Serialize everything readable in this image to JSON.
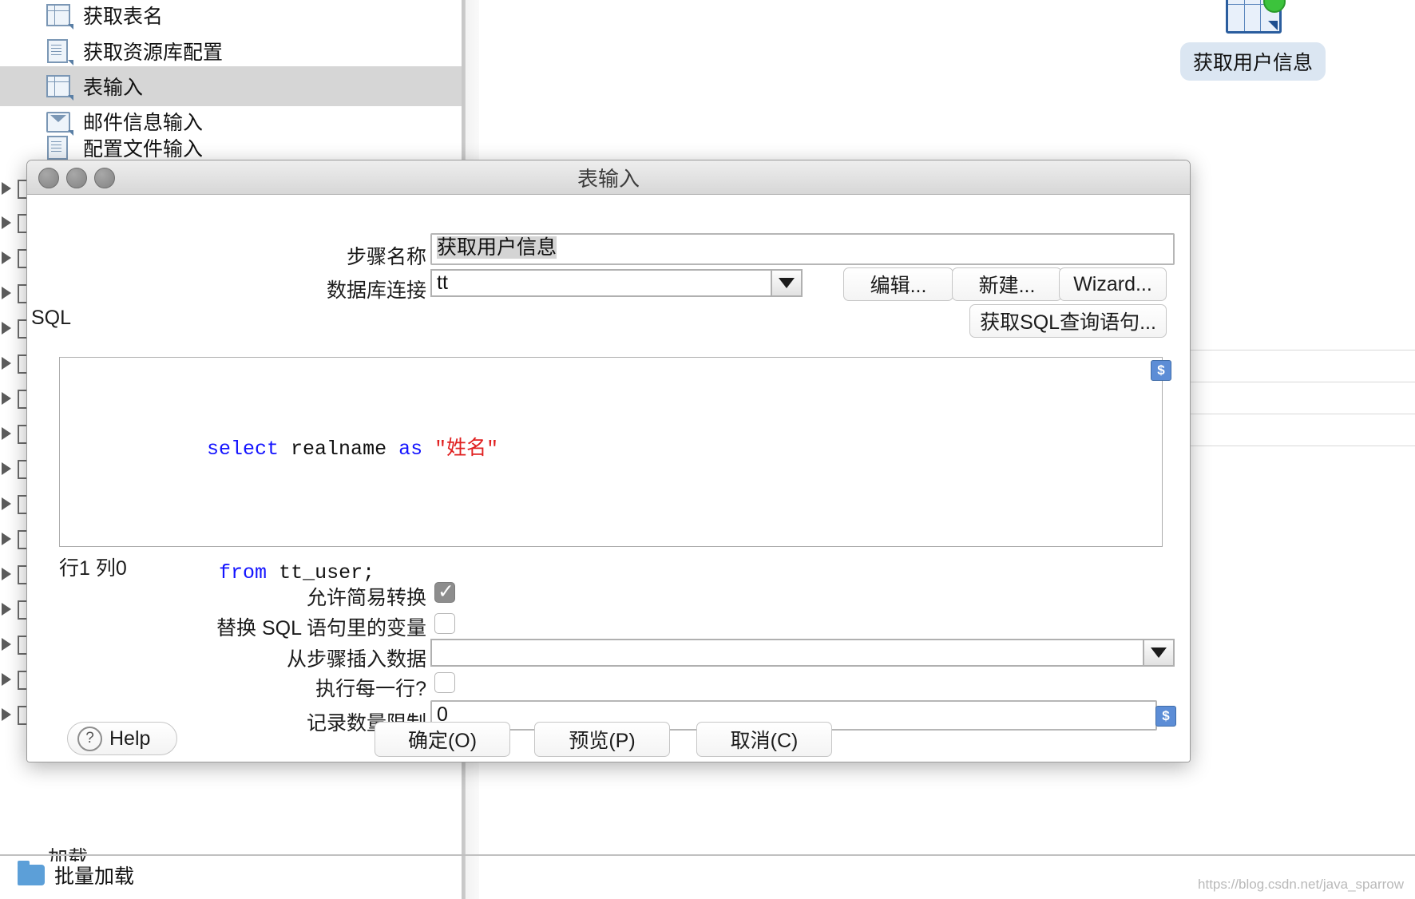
{
  "background": {
    "tree_items": [
      {
        "label": "获取表名",
        "icon": "table-icon",
        "selected": false
      },
      {
        "label": "获取资源库配置",
        "icon": "document-icon",
        "selected": false
      },
      {
        "label": "表输入",
        "icon": "table-icon",
        "selected": true
      },
      {
        "label": "邮件信息输入",
        "icon": "mail-icon",
        "selected": false
      },
      {
        "label": "配置文件输入",
        "icon": "list-icon",
        "selected": false
      }
    ],
    "canvas_node_label": "获取用户信息",
    "bottom_folder_label": "批量加载",
    "partial_label": "加载",
    "watermark": "https://blog.csdn.net/java_sparrow"
  },
  "dialog": {
    "title": "表输入",
    "step_name": {
      "label": "步骤名称",
      "value": "获取用户信息"
    },
    "connection": {
      "label": "数据库连接",
      "value": "tt",
      "edit_button": "编辑...",
      "new_button": "新建...",
      "wizard_button": "Wizard..."
    },
    "sql": {
      "label": "SQL",
      "get_sql_button": "获取SQL查询语句...",
      "lines": [
        [
          {
            "t": "select",
            "c": "k"
          },
          {
            "t": " realname ",
            "c": "p"
          },
          {
            "t": "as",
            "c": "k"
          },
          {
            "t": " ",
            "c": "p"
          },
          {
            "t": "\"姓名\"",
            "c": "s"
          }
        ],
        [
          {
            "t": " ",
            "c": "p"
          },
          {
            "t": "from",
            "c": "k"
          },
          {
            "t": " tt_user;",
            "c": "p"
          }
        ]
      ],
      "status": "行1 列0",
      "widget_icon": "variable-icon"
    },
    "options": [
      {
        "label": "允许简易转换",
        "type": "checkbox",
        "checked": true
      },
      {
        "label": "替换 SQL 语句里的变量",
        "type": "checkbox",
        "checked": false
      },
      {
        "label": "从步骤插入数据",
        "type": "combo",
        "value": ""
      },
      {
        "label": "执行每一行?",
        "type": "checkbox",
        "checked": false
      },
      {
        "label": "记录数量限制",
        "type": "text",
        "value": "0"
      }
    ],
    "footer": {
      "help": "Help",
      "ok": "确定(O)",
      "preview": "预览(P)",
      "cancel": "取消(C)"
    }
  },
  "colors": {
    "accent": "#5c8dd6",
    "keyword": "#1414ff",
    "string": "#e02020",
    "node_border": "#2a5d9e",
    "node_label_bg": "#dbe6f2",
    "selection": "#d4d4d4"
  }
}
